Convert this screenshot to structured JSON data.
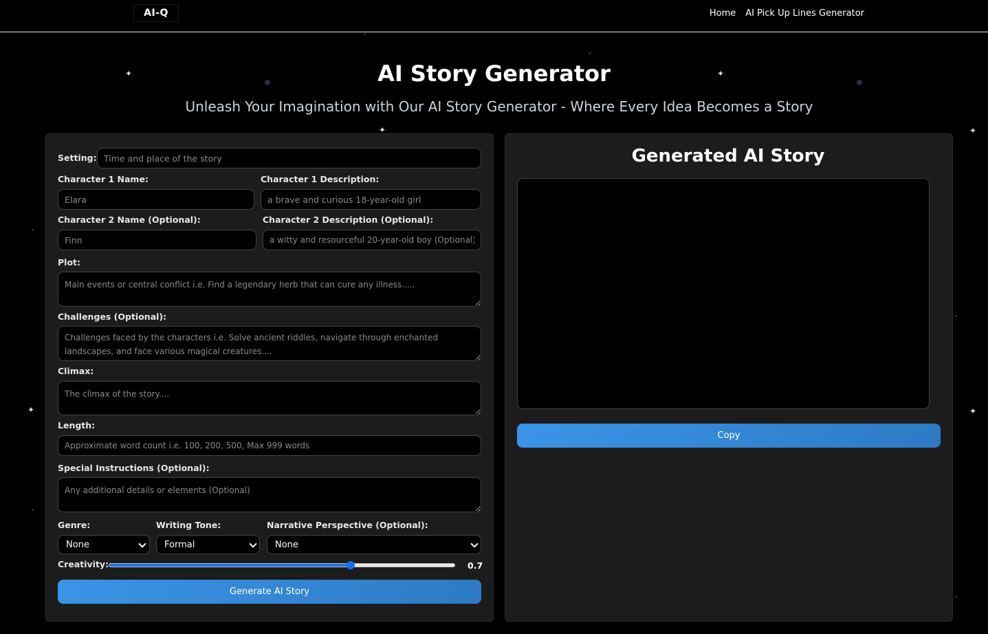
{
  "nav": {
    "logo": "AI-Q",
    "links": [
      {
        "label": "Home"
      },
      {
        "label": "AI Pick Up Lines Generator"
      }
    ]
  },
  "header": {
    "title": "AI Story Generator",
    "subtitle": "Unleash Your Imagination with Our AI Story Generator - Where Every Idea Becomes a Story"
  },
  "form": {
    "setting": {
      "label": "Setting:",
      "placeholder": "Time and place of the story",
      "value": ""
    },
    "char1_name": {
      "label": "Character 1 Name:",
      "placeholder": "Elara",
      "value": ""
    },
    "char1_desc": {
      "label": "Character 1 Description:",
      "placeholder": "a brave and curious 18-year-old girl",
      "value": ""
    },
    "char2_name": {
      "label": "Character 2 Name (Optional):",
      "placeholder": "Finn",
      "value": ""
    },
    "char2_desc": {
      "label": "Character 2 Description (Optional):",
      "placeholder": "a witty and resourceful 20-year-old boy (Optional)",
      "value": ""
    },
    "plot": {
      "label": "Plot:",
      "placeholder": "Main events or central conflict i.e. Find a legendary herb that can cure any illness.....",
      "value": ""
    },
    "challenges": {
      "label": "Challenges (Optional):",
      "placeholder": "Challenges faced by the characters i.e. Solve ancient riddles, navigate through enchanted landscapes, and face various magical creatures....",
      "value": ""
    },
    "climax": {
      "label": "Climax:",
      "placeholder": "The climax of the story....",
      "value": ""
    },
    "length": {
      "label": "Length:",
      "placeholder": "Approximate word count i.e. 100, 200, 500, Max 999 words",
      "value": ""
    },
    "special": {
      "label": "Special Instructions (Optional):",
      "placeholder": "Any additional details or elements (Optional)",
      "value": ""
    },
    "genre": {
      "label": "Genre:",
      "selected": "None"
    },
    "tone": {
      "label": "Writing Tone:",
      "selected": "Formal"
    },
    "perspective": {
      "label": "Narrative Perspective (Optional):",
      "selected": "None"
    },
    "creativity": {
      "label": "Creativity:",
      "value": 0.7,
      "value_text": "0.7",
      "min": 0,
      "max": 1
    },
    "generate_label": "Generate AI Story"
  },
  "output": {
    "title": "Generated AI Story",
    "story_text": "",
    "copy_label": "Copy"
  },
  "colors": {
    "accent": "#3a94e6",
    "panel_bg": "#1c1c1c",
    "page_bg": "#000000"
  }
}
